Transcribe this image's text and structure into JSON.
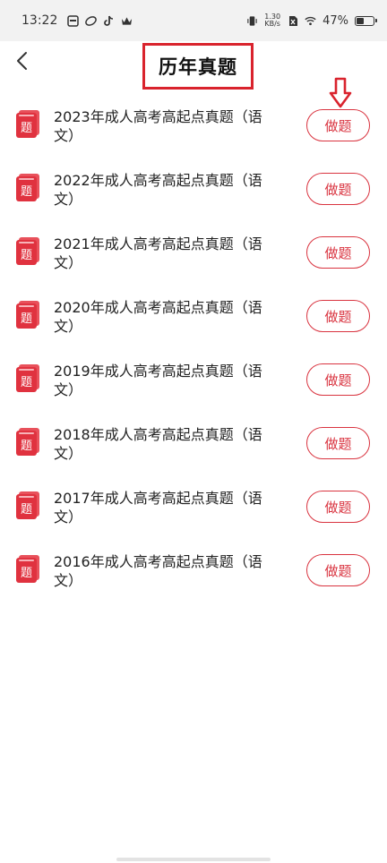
{
  "status_bar": {
    "time": "13:22",
    "net_speed_value": "1.30",
    "net_speed_unit": "KB/s",
    "battery_text": "47%",
    "battery_level": 0.47
  },
  "header": {
    "title": "历年真题"
  },
  "colors": {
    "accent": "#d9333f",
    "highlight_border": "#d9232d"
  },
  "list": {
    "icon_char": "题",
    "items": [
      {
        "title": "2023年成人高考高起点真题（语文）",
        "button": "做题"
      },
      {
        "title": "2022年成人高考高起点真题（语文）",
        "button": "做题"
      },
      {
        "title": "2021年成人高考高起点真题（语文）",
        "button": "做题"
      },
      {
        "title": "2020年成人高考高起点真题（语文）",
        "button": "做题"
      },
      {
        "title": "2019年成人高考高起点真题（语文）",
        "button": "做题"
      },
      {
        "title": "2018年成人高考高起点真题（语文）",
        "button": "做题"
      },
      {
        "title": "2017年成人高考高起点真题（语文）",
        "button": "做题"
      },
      {
        "title": "2016年成人高考高起点真题（语文）",
        "button": "做题"
      }
    ]
  }
}
